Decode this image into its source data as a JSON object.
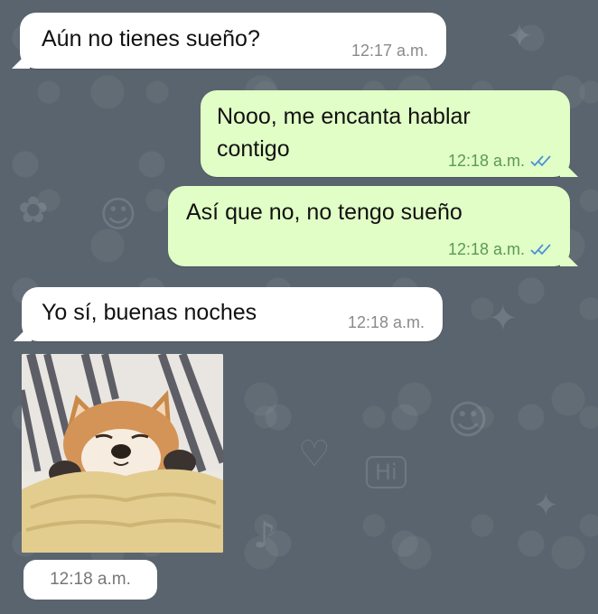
{
  "conversation": {
    "messages": [
      {
        "direction": "incoming",
        "text": "Aún no tienes sueño?",
        "time": "12:17 a.m."
      },
      {
        "direction": "outgoing",
        "line1": "Nooo, me encanta hablar",
        "line2": "contigo",
        "time": "12:18 a.m.",
        "status": "read-double-check-icon"
      },
      {
        "direction": "outgoing",
        "text": "Así que no, no tengo sueño",
        "time": "12:18 a.m.",
        "status": "read-double-check-icon"
      },
      {
        "direction": "incoming",
        "text": "Yo sí, buenas noches",
        "time": "12:18 a.m."
      }
    ],
    "sticker": {
      "description_icon": "sleeping-shiba-dog-sticker",
      "time": "12:18 a.m."
    },
    "wallpaper_doodle": "Hi"
  },
  "colors": {
    "background": "#59646e",
    "incoming_bubble": "#ffffff",
    "outgoing_bubble": "#e1fec6",
    "read_check": "#4a90d9"
  }
}
